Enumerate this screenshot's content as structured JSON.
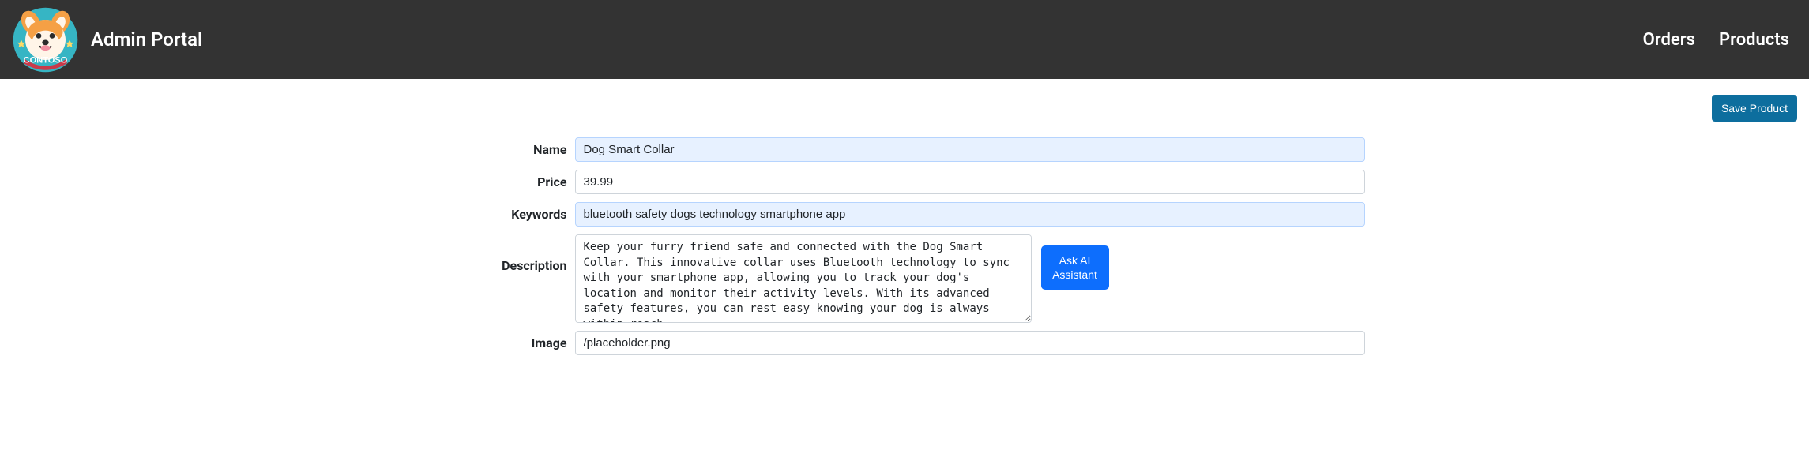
{
  "header": {
    "title": "Admin Portal",
    "nav": {
      "orders": "Orders",
      "products": "Products"
    }
  },
  "actions": {
    "save": "Save Product",
    "askAi": "Ask AI Assistant"
  },
  "form": {
    "labels": {
      "name": "Name",
      "price": "Price",
      "keywords": "Keywords",
      "description": "Description",
      "image": "Image"
    },
    "values": {
      "name": "Dog Smart Collar",
      "price": "39.99",
      "keywords": "bluetooth safety dogs technology smartphone app",
      "description": "Keep your furry friend safe and connected with the Dog Smart Collar. This innovative collar uses Bluetooth technology to sync with your smartphone app, allowing you to track your dog's location and monitor their activity levels. With its advanced safety features, you can rest easy knowing your dog is always within reach.",
      "image": "/placeholder.png"
    }
  }
}
